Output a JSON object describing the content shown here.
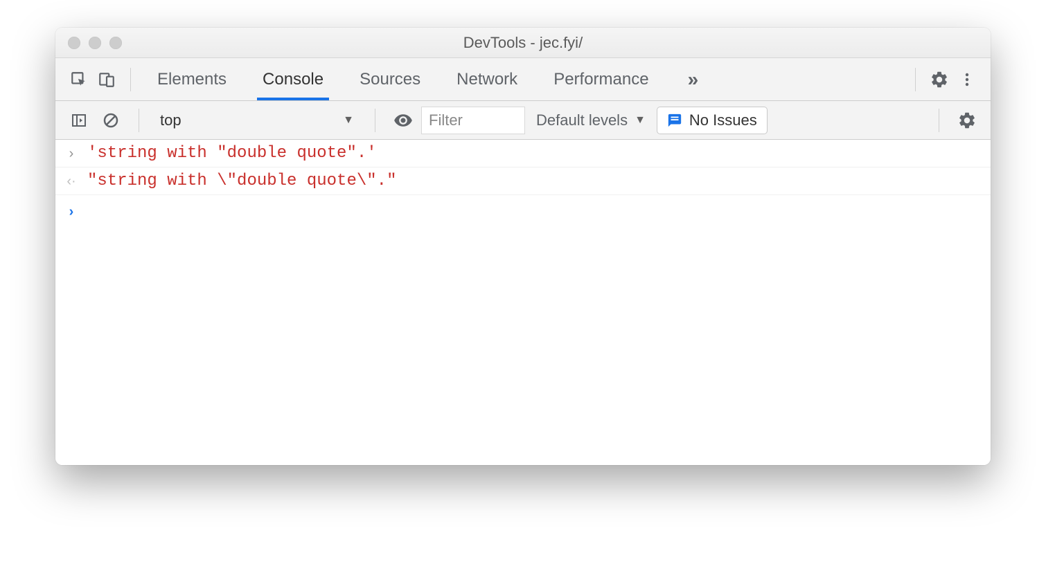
{
  "window": {
    "title": "DevTools - jec.fyi/"
  },
  "tabs": {
    "elements": "Elements",
    "console": "Console",
    "sources": "Sources",
    "network": "Network",
    "performance": "Performance"
  },
  "toolbar": {
    "context": "top",
    "filter_placeholder": "Filter",
    "levels": "Default levels",
    "issues": "No Issues"
  },
  "console": {
    "input_line": "'string with \"double quote\".'",
    "output_line": "\"string with \\\"double quote\\\".\""
  }
}
